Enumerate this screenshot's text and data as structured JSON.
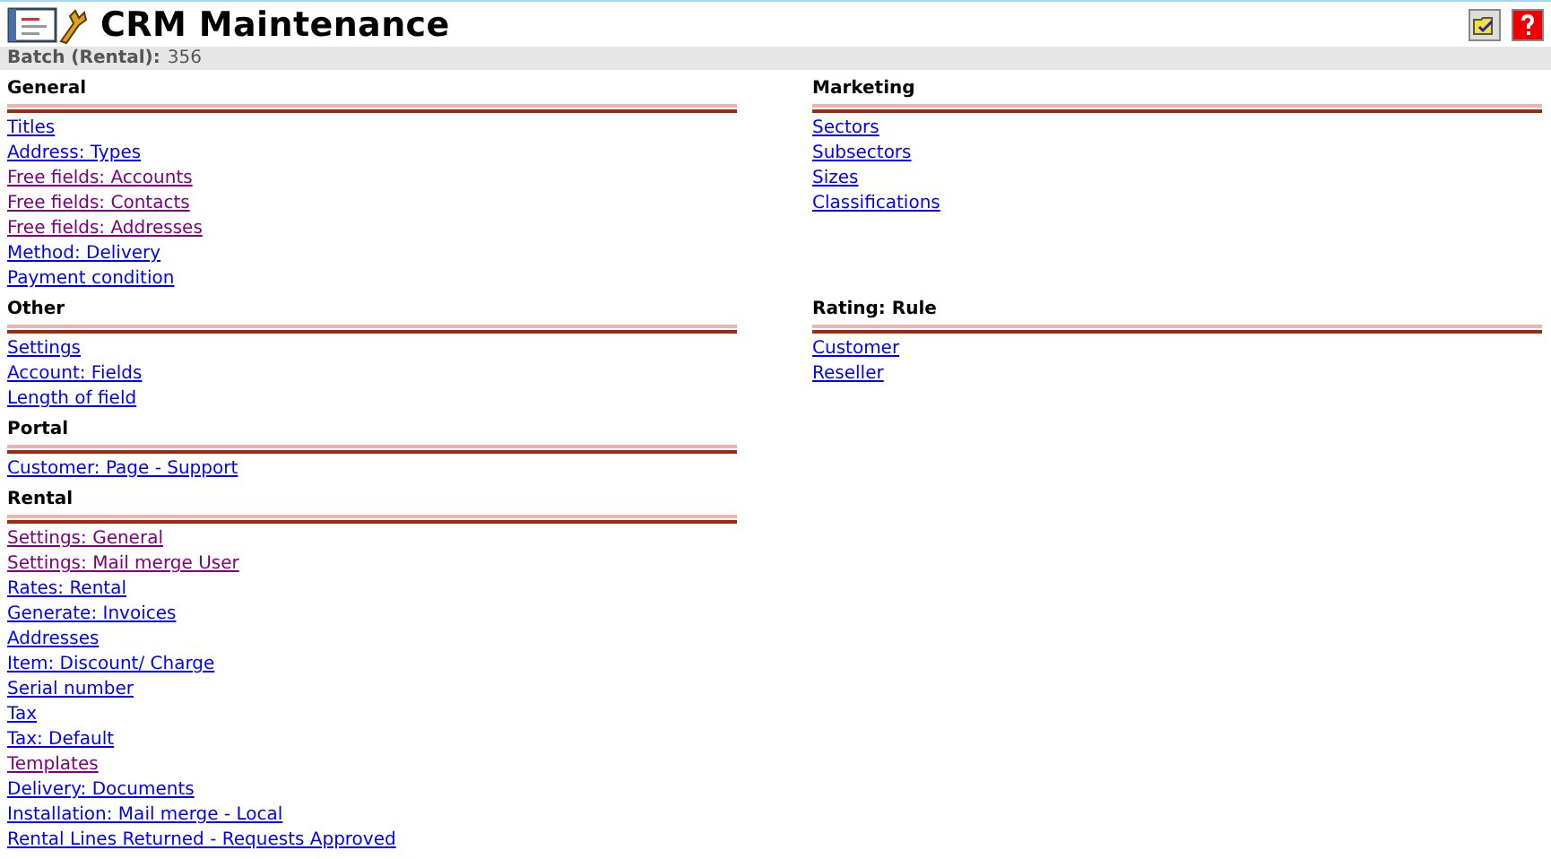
{
  "header": {
    "title": "CRM Maintenance",
    "batch_label": "Batch (Rental):",
    "batch_value": "356"
  },
  "rows": [
    {
      "left": {
        "title": "General",
        "links": [
          {
            "label": "Titles",
            "visited": false
          },
          {
            "label": "Address: Types",
            "visited": false
          },
          {
            "label": "Free fields: Accounts",
            "visited": true
          },
          {
            "label": "Free fields: Contacts",
            "visited": true
          },
          {
            "label": "Free fields: Addresses",
            "visited": true
          },
          {
            "label": "Method: Delivery",
            "visited": false
          },
          {
            "label": "Payment condition",
            "visited": false
          }
        ]
      },
      "right": {
        "title": "Marketing",
        "links": [
          {
            "label": "Sectors",
            "visited": false
          },
          {
            "label": "Subsectors",
            "visited": false
          },
          {
            "label": "Sizes",
            "visited": false
          },
          {
            "label": "Classifications",
            "visited": false
          }
        ]
      }
    },
    {
      "left": {
        "title": "Other",
        "links": [
          {
            "label": "Settings",
            "visited": false
          },
          {
            "label": "Account: Fields",
            "visited": false
          },
          {
            "label": "Length of field",
            "visited": false
          }
        ]
      },
      "right": {
        "title": "Rating: Rule",
        "links": [
          {
            "label": "Customer",
            "visited": false
          },
          {
            "label": "Reseller",
            "visited": false
          }
        ]
      }
    },
    {
      "left": {
        "title": "Portal",
        "links": [
          {
            "label": "Customer: Page - Support",
            "visited": false
          }
        ]
      }
    },
    {
      "left": {
        "title": "Rental",
        "links": [
          {
            "label": "Settings: General",
            "visited": true
          },
          {
            "label": "Settings: Mail merge User",
            "visited": true
          },
          {
            "label": "Rates: Rental",
            "visited": false
          },
          {
            "label": "Generate: Invoices",
            "visited": false
          },
          {
            "label": "Addresses",
            "visited": false
          },
          {
            "label": "Item: Discount/ Charge",
            "visited": false
          },
          {
            "label": "Serial number",
            "visited": false
          },
          {
            "label": "Tax",
            "visited": false
          },
          {
            "label": "Tax: Default",
            "visited": false
          },
          {
            "label": "Templates",
            "visited": true
          },
          {
            "label": "Delivery: Documents",
            "visited": false
          },
          {
            "label": "Installation: Mail merge - Local",
            "visited": false
          },
          {
            "label": "Rental Lines Returned - Requests Approved",
            "visited": false
          }
        ]
      }
    }
  ]
}
